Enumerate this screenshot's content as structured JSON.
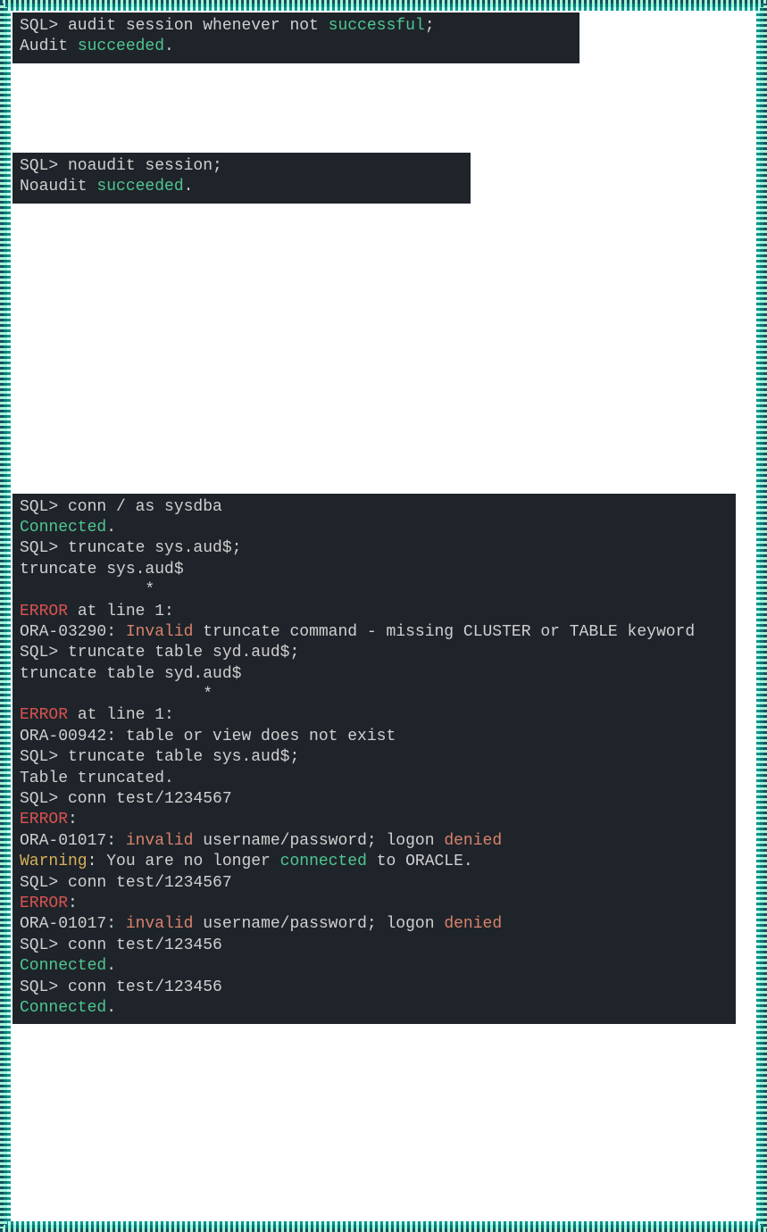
{
  "block1": {
    "l1a": "SQL> audit session whenever not ",
    "l1b": "successful",
    "l1c": ";",
    "l2": "",
    "l3a": "Audit ",
    "l3b": "succeeded",
    "l3c": "."
  },
  "block2": {
    "l1": "SQL> noaudit session;",
    "l2": "",
    "l3a": "Noaudit ",
    "l3b": "succeeded",
    "l3c": "."
  },
  "block3": {
    "l1": "SQL> conn / as sysdba",
    "l2a": "Connected",
    "l2b": ".",
    "l3": "SQL> truncate sys.aud$;",
    "l4": "truncate sys.aud$",
    "l5": "             *",
    "l6a": "ERROR",
    "l6b": " at line 1:",
    "l7a": "ORA-03290: ",
    "l7b": "Invalid",
    "l7c": " truncate command - missing CLUSTER or TABLE keyword",
    "l8": "",
    "l9": "",
    "l10": "SQL> truncate table syd.aud$;",
    "l11": "truncate table syd.aud$",
    "l12": "                   *",
    "l13a": "ERROR",
    "l13b": " at line 1:",
    "l14": "ORA-00942: table or view does not exist",
    "l15": "",
    "l16": "",
    "l17": "SQL> truncate table sys.aud$;",
    "l18": "",
    "l19": "Table truncated.",
    "l20": "",
    "l21": "SQL> conn test/1234567",
    "l22a": "ERROR",
    "l22b": ":",
    "l23a": "ORA-01017: ",
    "l23b": "invalid",
    "l23c": " username/password; logon ",
    "l23d": "denied",
    "l24": "",
    "l25": "",
    "l26a": "Warning",
    "l26b": ": You are no longer ",
    "l26c": "connected",
    "l26d": " to ORACLE.",
    "l27": "SQL> conn test/1234567",
    "l28a": "ERROR",
    "l28b": ":",
    "l29a": "ORA-01017: ",
    "l29b": "invalid",
    "l29c": " username/password; logon ",
    "l29d": "denied",
    "l30": "",
    "l31": "",
    "l32": "SQL> conn test/123456",
    "l33a": "Connected",
    "l33b": ".",
    "l34": "SQL> conn test/123456",
    "l35a": "Connected",
    "l35b": "."
  }
}
